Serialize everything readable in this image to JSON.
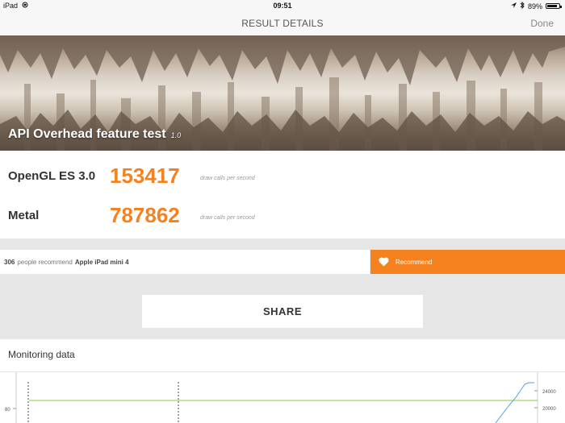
{
  "status_bar": {
    "device": "iPad",
    "time": "09:51",
    "battery": "89%",
    "battery_level": 0.89
  },
  "nav": {
    "title": "RESULT DETAILS",
    "done_label": "Done"
  },
  "hero": {
    "title": "API Overhead feature test",
    "version": "1.0"
  },
  "scores": [
    {
      "api": "OpenGL ES 3.0",
      "value": "153417",
      "unit": "draw calls per second"
    },
    {
      "api": "Metal",
      "value": "787862",
      "unit": "draw calls per second"
    }
  ],
  "recommend": {
    "count": "306",
    "text": "people recommend",
    "device": "Apple iPad mini 4",
    "button_label": "Recommend"
  },
  "share": {
    "label": "SHARE"
  },
  "monitoring": {
    "title": "Monitoring data",
    "left_tick": "80",
    "right_ticks": [
      "24000",
      "20000"
    ]
  }
}
